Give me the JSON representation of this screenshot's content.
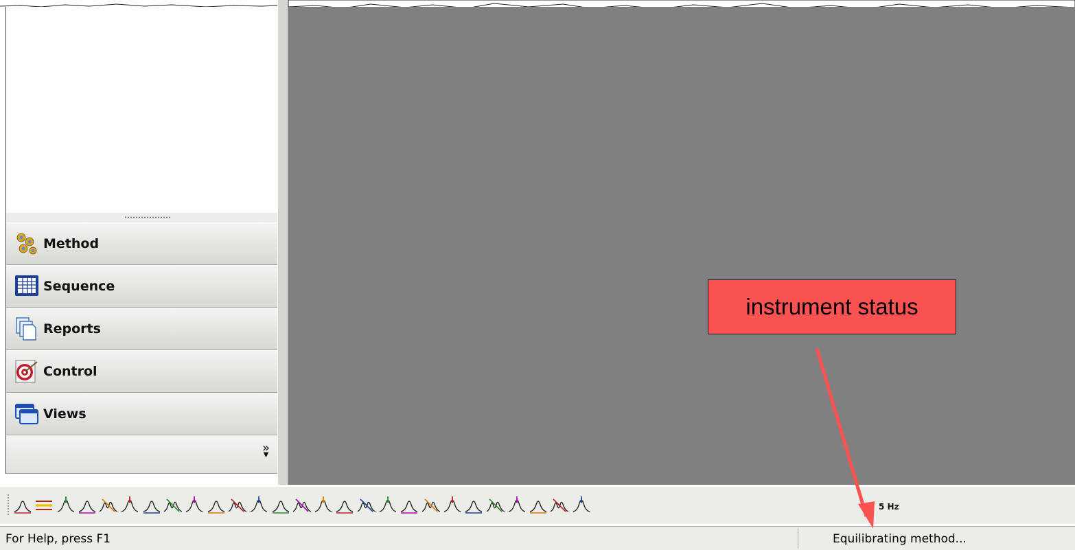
{
  "navigation": {
    "buttons": [
      {
        "label": "Method",
        "icon": "gears-icon"
      },
      {
        "label": "Sequence",
        "icon": "table-grid-icon"
      },
      {
        "label": "Reports",
        "icon": "documents-icon"
      },
      {
        "label": "Control",
        "icon": "target-icon"
      },
      {
        "label": "Views",
        "icon": "windows-icon"
      }
    ],
    "more_glyph": "»"
  },
  "toolbar": {
    "icons": [
      "peak-width-icon",
      "baseline-icon",
      "peak-mark-icon",
      "delete-peak-icon",
      "split-peak-icon",
      "valley-icon",
      "tangent-skim-icon",
      "double-peak-icon",
      "peak-start-icon",
      "peak-end-icon",
      "integrate-window-icon",
      "negative-peak-icon",
      "reject-peak-icon",
      "area-sum-icon",
      "manual-baseline-icon",
      "threshold-icon",
      "force-peak-icon",
      "drop-line-icon",
      "front-tangent-icon",
      "rear-tangent-icon",
      "shoulder-icon",
      "exponential-skim-icon",
      "manual-peak-icon",
      "manual-valley-icon",
      "peak-label-icon",
      "overlay-icon",
      "unknown-peak-icon"
    ],
    "sampling_rate": "5 Hz"
  },
  "status_bar": {
    "help_text": "For Help, press F1",
    "instrument_status": "Equilibrating method..."
  },
  "annotation": {
    "text": "instrument status",
    "color": "#fb5252"
  },
  "colors": {
    "mdi_background": "#808080",
    "panel": "#ecece8"
  }
}
